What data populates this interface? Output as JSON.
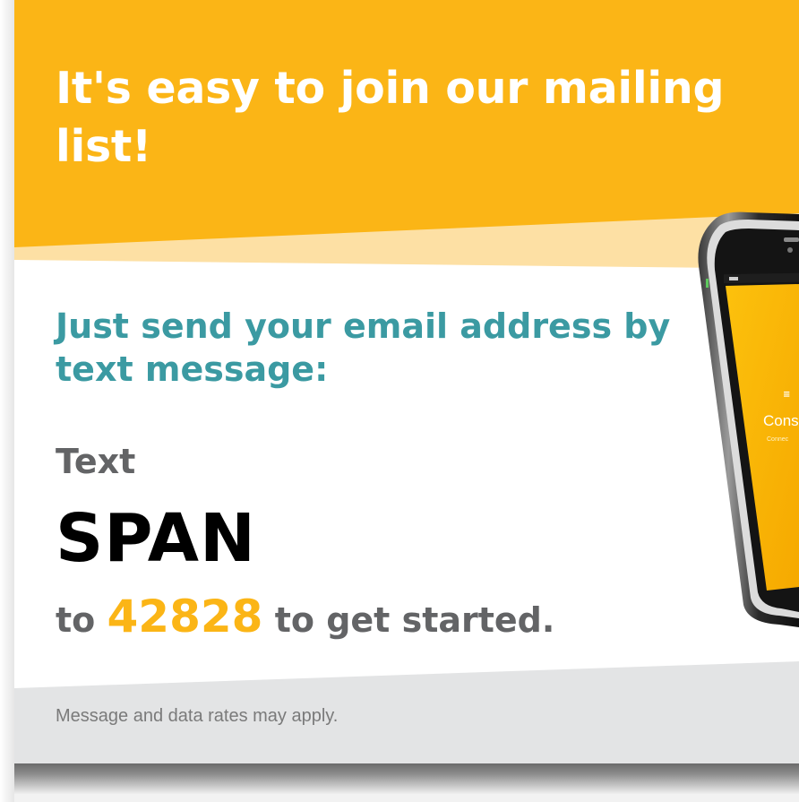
{
  "headline": "It's easy to join our mailing list!",
  "subheading": "Just send your email address by text message:",
  "instruction": {
    "text_label": "Text",
    "keyword": "SPAN",
    "to_word": "to",
    "shortcode": "42828",
    "suffix": "to get started."
  },
  "disclaimer": "Message and data rates may apply.",
  "phone": {
    "screen_logo_text": "Cons",
    "screen_tagline_text": "Connec"
  },
  "colors": {
    "header_orange": "#fbb516",
    "light_orange_band": "#fde0a4",
    "teal": "#3b9aa2",
    "gray_text": "#636466",
    "shortcode_orange": "#fbb516",
    "footer_gray": "#e3e4e5"
  }
}
